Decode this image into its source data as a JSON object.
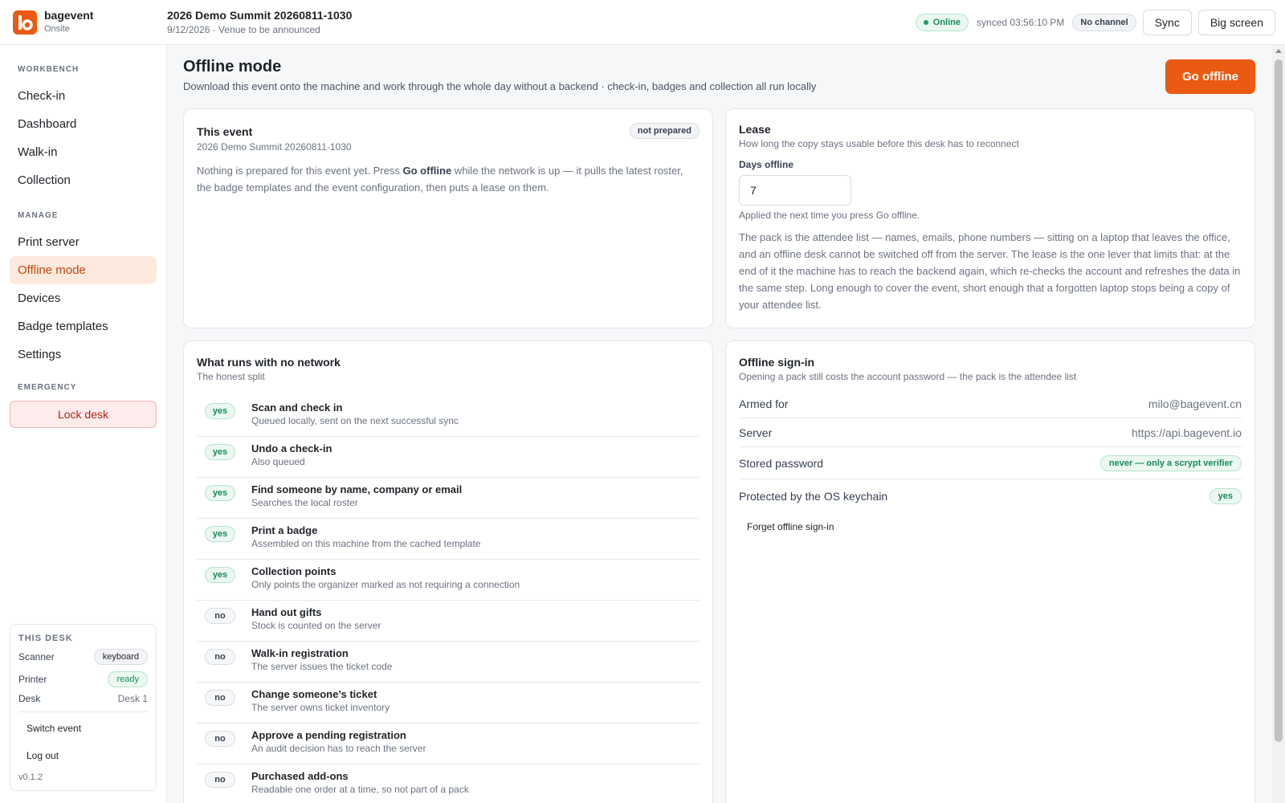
{
  "app": {
    "brand": "bagevent",
    "brand_sub": "Onsite"
  },
  "event": {
    "title": "2026 Demo Summit 20260811-1030",
    "subtitle": "9/12/2026 · Venue to be announced"
  },
  "status": {
    "online": "Online",
    "synced": "synced 03:56:10 PM",
    "channel": "No channel",
    "sync_btn": "Sync",
    "bigscreen_btn": "Big screen"
  },
  "sidebar": {
    "workbench_head": "WORKBENCH",
    "workbench": [
      {
        "label": "Check-in"
      },
      {
        "label": "Dashboard"
      },
      {
        "label": "Walk-in"
      },
      {
        "label": "Collection"
      }
    ],
    "manage_head": "MANAGE",
    "manage": [
      {
        "label": "Print server"
      },
      {
        "label": "Offline mode",
        "active": true
      },
      {
        "label": "Devices"
      },
      {
        "label": "Badge templates"
      },
      {
        "label": "Settings"
      }
    ],
    "emergency_head": "EMERGENCY",
    "lock_btn": "Lock desk",
    "desk": {
      "head": "THIS DESK",
      "scanner_label": "Scanner",
      "scanner_value": "keyboard",
      "printer_label": "Printer",
      "printer_value": "ready",
      "desk_label": "Desk",
      "desk_value": "Desk 1",
      "switch_event": "Switch event",
      "logout": "Log out",
      "version": "v0.1.2"
    }
  },
  "page": {
    "title": "Offline mode",
    "subtitle": "Download this event onto the machine and work through the whole day without a backend · check-in, badges and collection all run locally",
    "go_offline": "Go offline"
  },
  "this_event": {
    "title": "This event",
    "subtitle": "2026 Demo Summit 20260811-1030",
    "badge": "not prepared",
    "body_pre": "Nothing is prepared for this event yet. Press ",
    "body_bold": "Go offline",
    "body_post": " while the network is up — it pulls the latest roster, the badge templates and the event configuration, then puts a lease on them."
  },
  "lease": {
    "title": "Lease",
    "subtitle": "How long the copy stays usable before this desk has to reconnect",
    "field_label": "Days offline",
    "value": "7",
    "hint": "Applied the next time you press Go offline.",
    "body": "The pack is the attendee list — names, emails, phone numbers — sitting on a laptop that leaves the office, and an offline desk cannot be switched off from the server. The lease is the one lever that limits that: at the end of it the machine has to reach the backend again, which re-checks the account and refreshes the data in the same step. Long enough to cover the event, short enough that a forgotten laptop stops being a copy of your attendee list."
  },
  "runs": {
    "title": "What runs with no network",
    "subtitle": "The honest split",
    "items": [
      {
        "status": "yes",
        "title": "Scan and check in",
        "desc": "Queued locally, sent on the next successful sync"
      },
      {
        "status": "yes",
        "title": "Undo a check-in",
        "desc": "Also queued"
      },
      {
        "status": "yes",
        "title": "Find someone by name, company or email",
        "desc": "Searches the local roster"
      },
      {
        "status": "yes",
        "title": "Print a badge",
        "desc": "Assembled on this machine from the cached template"
      },
      {
        "status": "yes",
        "title": "Collection points",
        "desc": "Only points the organizer marked as not requiring a connection"
      },
      {
        "status": "no",
        "title": "Hand out gifts",
        "desc": "Stock is counted on the server"
      },
      {
        "status": "no",
        "title": "Walk-in registration",
        "desc": "The server issues the ticket code"
      },
      {
        "status": "no",
        "title": "Change someone’s ticket",
        "desc": "The server owns ticket inventory"
      },
      {
        "status": "no",
        "title": "Approve a pending registration",
        "desc": "An audit decision has to reach the server"
      },
      {
        "status": "no",
        "title": "Purchased add-ons",
        "desc": "Readable one order at a time, so not part of a pack"
      }
    ]
  },
  "signin": {
    "title": "Offline sign-in",
    "subtitle": "Opening a pack still costs the account password — the pack is the attendee list",
    "armed_label": "Armed for",
    "armed_value": "milo@bagevent.cn",
    "server_label": "Server",
    "server_value": "https://api.bagevent.io",
    "pw_label": "Stored password",
    "pw_value": "never — only a scrypt verifier",
    "keychain_label": "Protected by the OS keychain",
    "keychain_value": "yes",
    "forget": "Forget offline sign-in"
  },
  "colors": {
    "accent": "#ea5a12",
    "success": "#1a8a5a",
    "danger": "#b42318"
  }
}
